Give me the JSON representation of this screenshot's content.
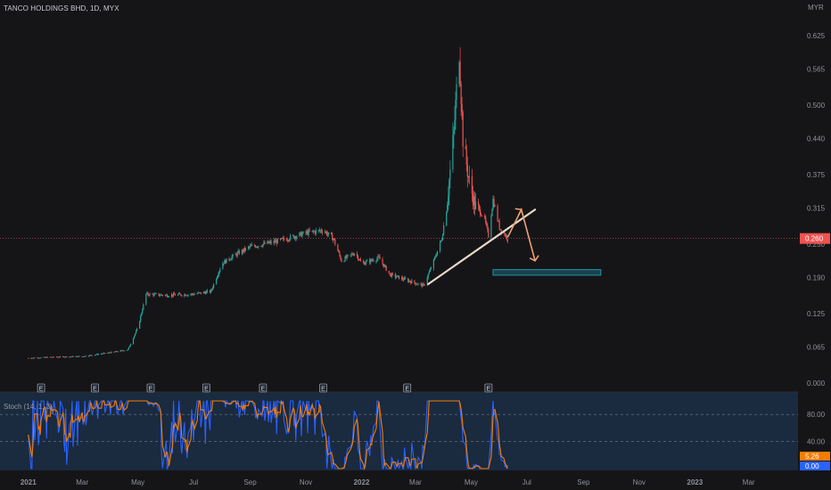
{
  "header": {
    "title": "TANCO HOLDINGS BHD, 1D, MYX"
  },
  "currency": "MYR",
  "last_price_label": "0.260",
  "earnings_marker": "E",
  "stoch": {
    "title": "Stoch (14, 1, 3)",
    "k_label": "5.26",
    "d_label": "0.00",
    "levels": [
      "80.00",
      "40.00"
    ]
  },
  "colors": {
    "background": "#151518",
    "up": "#26a69a",
    "down": "#ef5350",
    "price_line": "#ef5350",
    "trendline": "#e6d8c6",
    "arrow": "#f0a070",
    "target_box": "#2196a8",
    "stoch_k": "#2962ff",
    "stoch_d": "#f57c00"
  },
  "chart_data": {
    "type": "candlestick",
    "title": "TANCO HOLDINGS BHD, 1D, MYX",
    "y_ticks": [
      "0.625",
      "0.565",
      "0.500",
      "0.440",
      "0.375",
      "0.315",
      "0.250",
      "0.190",
      "0.125",
      "0.065",
      "0.000"
    ],
    "x_ticks": [
      "2021",
      "Mar",
      "May",
      "Jul",
      "Sep",
      "Nov",
      "2022",
      "Mar",
      "May",
      "Jul",
      "Sep",
      "Nov",
      "2023",
      "Mar"
    ],
    "ylim": [
      0.0,
      0.66
    ],
    "price_path": [
      [
        "2021-01",
        0.045
      ],
      [
        "2021-02",
        0.047
      ],
      [
        "2021-03",
        0.048
      ],
      [
        "2021-04",
        0.055
      ],
      [
        "2021-04-20",
        0.06
      ],
      [
        "2021-05-01",
        0.1
      ],
      [
        "2021-05-10",
        0.16
      ],
      [
        "2021-06",
        0.158
      ],
      [
        "2021-07",
        0.16
      ],
      [
        "2021-07-20",
        0.165
      ],
      [
        "2021-08",
        0.215
      ],
      [
        "2021-08-15",
        0.23
      ],
      [
        "2021-09",
        0.245
      ],
      [
        "2021-10",
        0.255
      ],
      [
        "2021-11",
        0.27
      ],
      [
        "2021-11-20",
        0.275
      ],
      [
        "2021-12-01",
        0.26
      ],
      [
        "2021-12-10",
        0.22
      ],
      [
        "2021-12-25",
        0.235
      ],
      [
        "2022-01",
        0.215
      ],
      [
        "2022-01-20",
        0.225
      ],
      [
        "2022-02",
        0.195
      ],
      [
        "2022-03",
        0.18
      ],
      [
        "2022-03-10",
        0.175
      ],
      [
        "2022-03-20",
        0.215
      ],
      [
        "2022-03-30",
        0.26
      ],
      [
        "2022-04-05",
        0.33
      ],
      [
        "2022-04-12",
        0.45
      ],
      [
        "2022-04-18",
        0.6
      ],
      [
        "2022-04-22",
        0.44
      ],
      [
        "2022-04-28",
        0.37
      ],
      [
        "2022-05-05",
        0.32
      ],
      [
        "2022-05-15",
        0.3
      ],
      [
        "2022-05-20",
        0.265
      ],
      [
        "2022-05-25",
        0.33
      ],
      [
        "2022-06-01",
        0.28
      ],
      [
        "2022-06-10",
        0.26
      ]
    ],
    "last_price": 0.26,
    "drawings": {
      "trendline": [
        [
          "2022-03-15",
          0.178
        ],
        [
          "2022-07-10",
          0.312
        ]
      ],
      "projection_arrow": [
        [
          "2022-06-10",
          0.262
        ],
        [
          "2022-06-25",
          0.312
        ],
        [
          "2022-07-10",
          0.22
        ]
      ],
      "target_zone": {
        "x": [
          "2022-05-25",
          "2022-09-20"
        ],
        "y": [
          0.194,
          0.204
        ]
      }
    },
    "stoch": {
      "k_last": 5.26,
      "d_last": 0.0,
      "levels": [
        80,
        40
      ],
      "ylim": [
        0,
        100
      ]
    }
  }
}
